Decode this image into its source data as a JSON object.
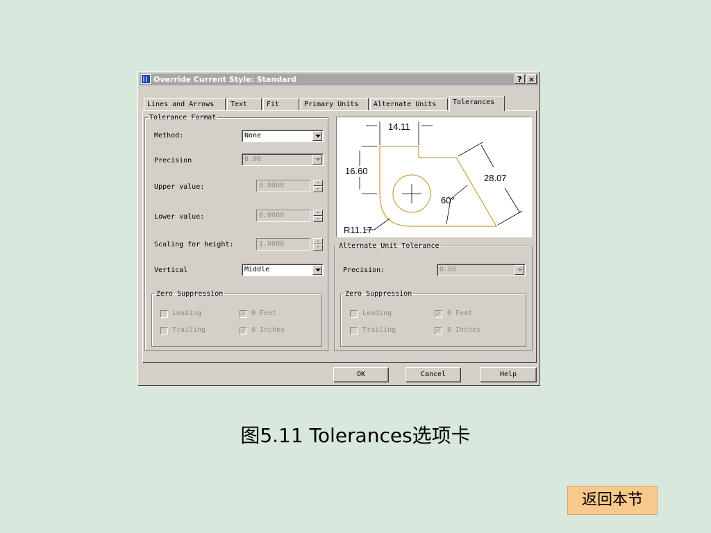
{
  "dialog": {
    "title": "Override Current Style: Standard",
    "help_btn": "?",
    "close_btn": "×",
    "tabs": [
      {
        "label": "Lines and Arrows"
      },
      {
        "label": "Text"
      },
      {
        "label": "Fit"
      },
      {
        "label": "Primary Units"
      },
      {
        "label": "Alternate Units"
      },
      {
        "label": "Tolerances"
      }
    ],
    "active_tab": "Tolerances",
    "tolerance_format": {
      "legend": "Tolerance Format",
      "method_label": "Method:",
      "method_value": "None",
      "precision_label": "Precision",
      "precision_value": "0.00",
      "upper_label": "Upper value:",
      "upper_value": "0.0000",
      "lower_label": "Lower value:",
      "lower_value": "0.0000",
      "scaling_label": "Scaling for height:",
      "scaling_value": "1.0000",
      "vertical_label": "Vertical",
      "vertical_value": "Middle",
      "zero_suppression": {
        "legend": "Zero Suppression",
        "leading": "Leading",
        "trailing": "Trailing",
        "feet": "0 Feet",
        "inches": "0 Inches"
      }
    },
    "preview": {
      "dim_top": "14.11",
      "dim_left": "16.60",
      "dim_right": "28.07",
      "dim_angle": "60°",
      "dim_radius": "R11.17"
    },
    "alternate_unit_tolerance": {
      "legend": "Alternate Unit Tolerance",
      "precision_label": "Precision:",
      "precision_value": "0.00",
      "zero_suppression": {
        "legend": "Zero Suppression",
        "leading": "Leading",
        "trailing": "Trailing",
        "feet": "0 Feet",
        "inches": "0 Inches"
      }
    },
    "buttons": {
      "ok": "OK",
      "cancel": "Cancel",
      "help": "Help"
    }
  },
  "caption": "图5.11  Tolerances选项卡",
  "back_button": "返回本节",
  "colors": {
    "background": "#d9e8dc",
    "dialog": "#d4d0c8",
    "preview_line": "#c8a040",
    "back_button": "#f8c98c"
  }
}
